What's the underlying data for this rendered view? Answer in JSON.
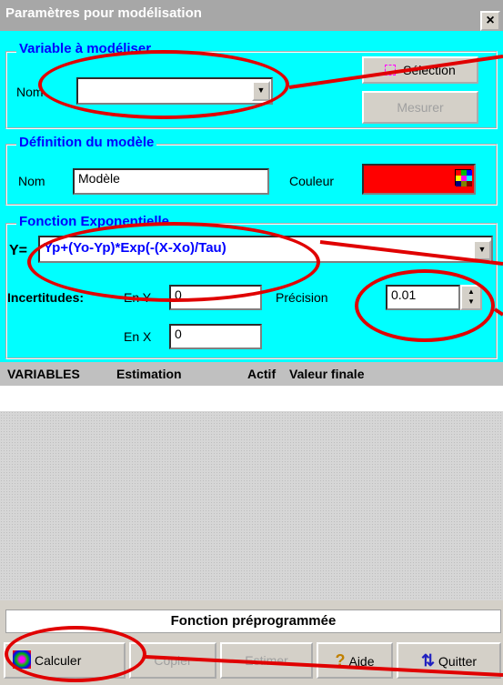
{
  "window": {
    "title": "Paramètres pour modélisation",
    "close_glyph": "×"
  },
  "variable_group": {
    "legend": "Variable à modéliser",
    "nom_label": "Nom",
    "nom_value": "",
    "selection_button": "Sélection",
    "mesurer_button": "Mesurer"
  },
  "model_group": {
    "legend": "Définition du modèle",
    "nom_label": "Nom",
    "nom_value": "Modèle",
    "couleur_label": "Couleur",
    "couleur_value": "#ff0000"
  },
  "function_group": {
    "legend": "Fonction Exponentielle",
    "y_label": "Y=",
    "formula": "Yp+(Yo-Yp)*Exp(-(X-Xo)/Tau)",
    "incertitudes_label": "Incertitudes:",
    "en_y_label": "En Y",
    "en_y_value": "0",
    "en_x_label": "En X",
    "en_x_value": "0",
    "precision_label": "Précision",
    "precision_value": "0.01"
  },
  "table": {
    "columns": [
      "VARIABLES",
      "Estimation",
      "Actif",
      "Valeur finale"
    ],
    "rows": []
  },
  "footer": {
    "function_label": "Fonction préprogrammée",
    "buttons": {
      "calculer": "Calculer",
      "copier": "Copier",
      "estimer": "Estimer",
      "aide": "Aide",
      "quitter": "Quitter"
    }
  },
  "colors": {
    "panel": "#00ffff",
    "legend_text": "#0000ff",
    "annotation": "#e00000",
    "titlebar": "#a7a7a7"
  }
}
